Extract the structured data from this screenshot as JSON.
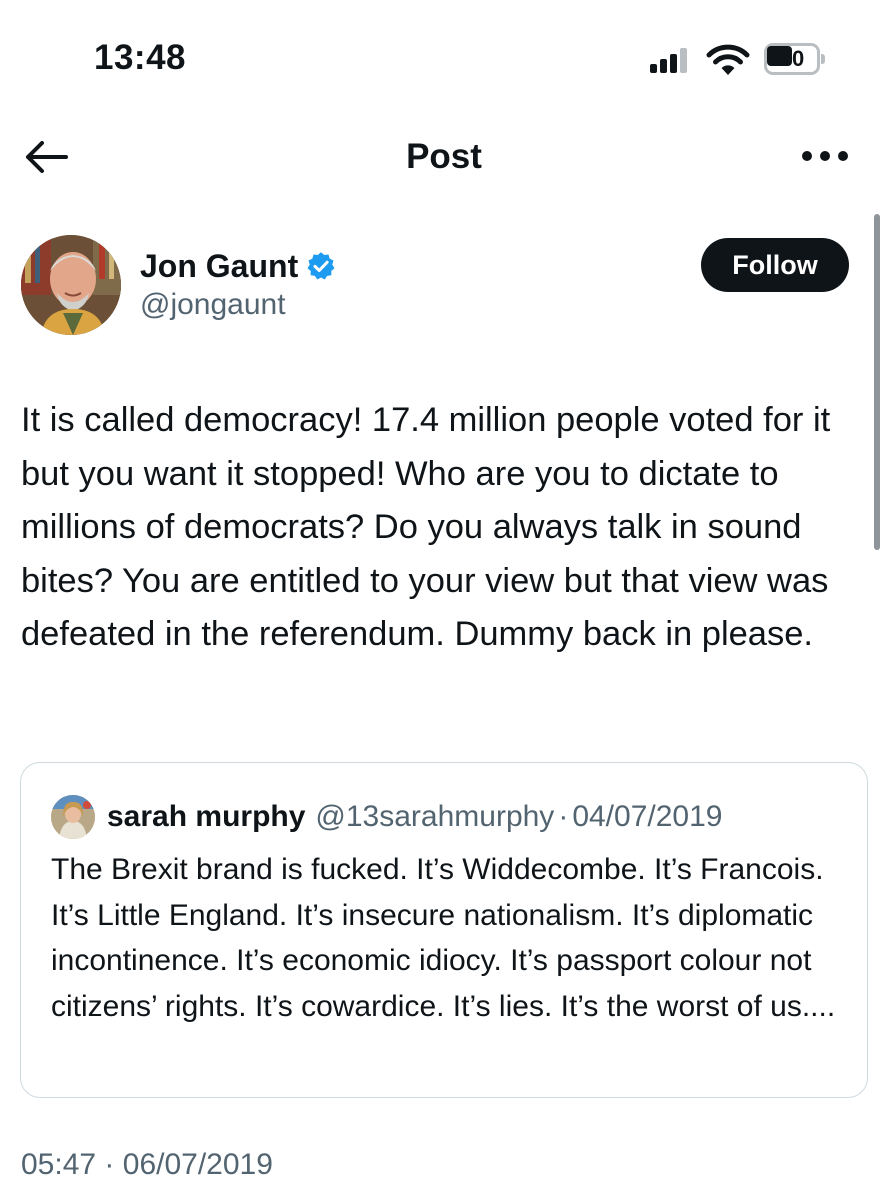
{
  "status_bar": {
    "time": "13:48",
    "battery_level": "50",
    "icons": [
      "signal-icon",
      "wifi-icon",
      "battery-icon"
    ]
  },
  "header": {
    "title": "Post",
    "back_icon": "arrow-left-icon",
    "more_icon": "more-horizontal-icon"
  },
  "post": {
    "author": {
      "name": "Jon Gaunt",
      "handle": "@jongaunt",
      "verified": true
    },
    "follow_label": "Follow",
    "text": "It is called democracy! 17.4 million people voted for it but you want it stopped! Who are you to dictate to millions of democrats? Do you always talk in sound bites? You are entitled to your view but that view was defeated in the referendum. Dummy back in please.",
    "time": "05:47",
    "date": "06/07/2019",
    "separator": "·"
  },
  "quoted_post": {
    "author_name": "sarah murphy",
    "author_handle": "@13sarahmurphy",
    "separator": "·",
    "date": "04/07/2019",
    "text": "The Brexit brand is fucked. It’s Widdecombe. It’s Francois. It’s Little England. It’s insecure nationalism. It’s diplomatic incontinence. It’s economic idiocy. It’s passport colour not citizens’ rights. It’s cowardice. It’s lies. It’s the worst of us...."
  },
  "colors": {
    "text_primary": "#0f1419",
    "text_secondary": "#536471",
    "verified_blue": "#1d9bf0",
    "border": "#cfd9de"
  }
}
